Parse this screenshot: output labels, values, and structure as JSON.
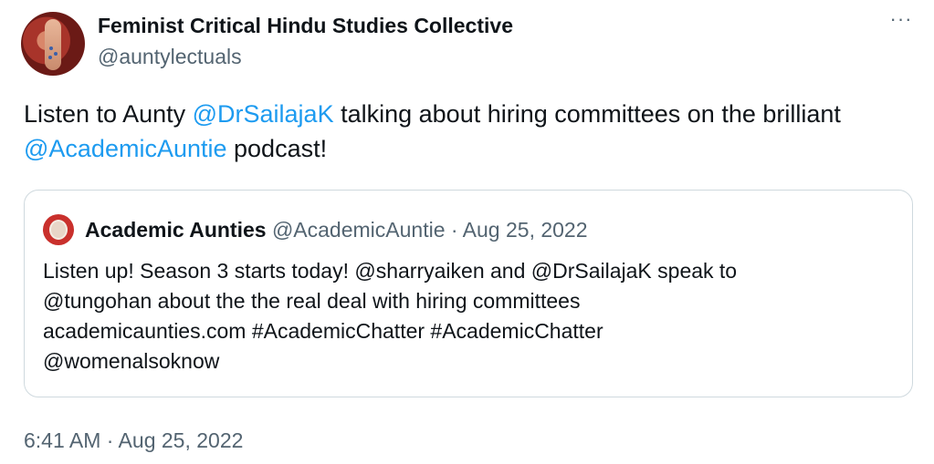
{
  "author": {
    "name": "Feminist Critical Hindu Studies Collective",
    "handle": "@auntylectuals"
  },
  "more_label": "···",
  "tweet": {
    "text_1": "Listen to Aunty ",
    "mention_1": "@DrSailajaK",
    "text_2": " talking about hiring committees on the brilliant ",
    "mention_2": "@AcademicAuntie",
    "text_3": " podcast!"
  },
  "quoted": {
    "name": "Academic Aunties",
    "handle": "@AcademicAuntie",
    "separator": " · ",
    "date": "Aug 25, 2022",
    "lines": [
      "Listen up! Season 3 starts today! @sharryaiken and @DrSailajaK speak  to",
      "@tungohan about the the real deal with hiring committees",
      "academicaunties.com #AcademicChatter #AcademicChatter",
      "@womenalsoknow"
    ]
  },
  "timestamp": "6:41 AM · Aug 25, 2022",
  "colors": {
    "link": "#1d9bf0",
    "muted": "#536471",
    "text": "#0f1419",
    "border": "#cfd9de"
  }
}
